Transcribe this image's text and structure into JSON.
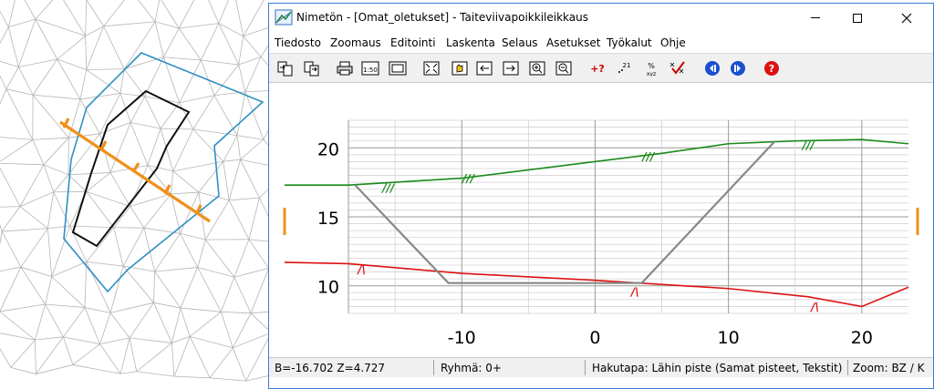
{
  "window": {
    "title": "Nimetön - [Omat_oletukset] - Taiteviivapoikkileikkaus",
    "minimize_icon": "minimize-icon",
    "maximize_icon": "maximize-icon",
    "close_icon": "close-icon"
  },
  "menu": [
    {
      "label": "Tiedosto"
    },
    {
      "label": "Zoomaus"
    },
    {
      "label": "Editointi"
    },
    {
      "label": "Laskenta"
    },
    {
      "label": "Selaus"
    },
    {
      "label": "Asetukset"
    },
    {
      "label": "Työkalut"
    },
    {
      "label": "Ohje"
    }
  ],
  "toolbar": {
    "buttons": [
      {
        "icon": "copy-in-icon"
      },
      {
        "icon": "copy-out-icon"
      },
      {
        "icon": "print-icon"
      },
      {
        "icon": "scale-150-icon",
        "label": "1:50"
      },
      {
        "icon": "page-setup-icon"
      },
      {
        "icon": "fit-view-icon"
      },
      {
        "icon": "pan-icon"
      },
      {
        "icon": "arrow-left-icon"
      },
      {
        "icon": "arrow-right-icon"
      },
      {
        "icon": "zoom-in-icon"
      },
      {
        "icon": "zoom-out-icon"
      },
      {
        "icon": "point-query-icon",
        "label": "+?"
      },
      {
        "icon": "point-number-icon",
        "label": "21"
      },
      {
        "icon": "percent-xyz-icon",
        "label": "xyz"
      },
      {
        "icon": "xyz-check-icon"
      },
      {
        "icon": "previous-icon"
      },
      {
        "icon": "next-icon"
      },
      {
        "icon": "help-icon",
        "label": "?"
      }
    ]
  },
  "chart_data": {
    "type": "line",
    "xlim": [
      -18.5,
      23.5
    ],
    "ylim": [
      8.0,
      22.0
    ],
    "x_ticks": [
      -10,
      0,
      10,
      20
    ],
    "x_tick_labels": [
      "-10",
      "0",
      "10",
      "20"
    ],
    "y_ticks": [
      10,
      15,
      20
    ],
    "y_tick_labels": [
      "10",
      "15",
      "20"
    ],
    "grid": true,
    "series": [
      {
        "color": "#1a8a1a",
        "x": [
          -23.5,
          -18.5,
          -10,
          5,
          10,
          15,
          20,
          23.5
        ],
        "y": [
          17.3,
          17.3,
          17.8,
          19.6,
          20.3,
          20.5,
          20.6,
          20.3
        ]
      },
      {
        "color": "#dd1111",
        "x": [
          -23.5,
          -18.5,
          -10,
          0,
          10,
          16,
          20,
          23.5
        ],
        "y": [
          11.7,
          11.6,
          10.9,
          10.4,
          9.8,
          9.2,
          8.5,
          9.9
        ]
      },
      {
        "color": "#888888",
        "x": [
          -18,
          -11,
          3.5,
          13.5
        ],
        "y": [
          17.3,
          10.2,
          10.2,
          20.5
        ]
      }
    ],
    "annotations": [
      {
        "symbol": "///",
        "color": "#1a8a1a",
        "x": -15.5,
        "y": 17.2
      },
      {
        "symbol": "///",
        "color": "#1a8a1a",
        "x": -9.5,
        "y": 17.9
      },
      {
        "symbol": "///",
        "color": "#1a8a1a",
        "x": 4,
        "y": 19.5
      },
      {
        "symbol": "///",
        "color": "#1a8a1a",
        "x": 16,
        "y": 20.3
      },
      {
        "symbol": "/\\",
        "color": "#dd1111",
        "x": -17.5,
        "y": 11.3
      },
      {
        "symbol": "/\\",
        "color": "#dd1111",
        "x": 3,
        "y": 9.7
      },
      {
        "symbol": "/\\",
        "color": "#dd1111",
        "x": 16.5,
        "y": 8.6
      }
    ],
    "section_markers_color": "#f0901a"
  },
  "status": {
    "coords": "B=-16.702  Z=4.727",
    "group": "Ryhmä: 0+",
    "search": "Hakutapa: Lähin piste (Samat pisteet, Tekstit)",
    "zoom": "Zoom: BZ  /  K"
  }
}
